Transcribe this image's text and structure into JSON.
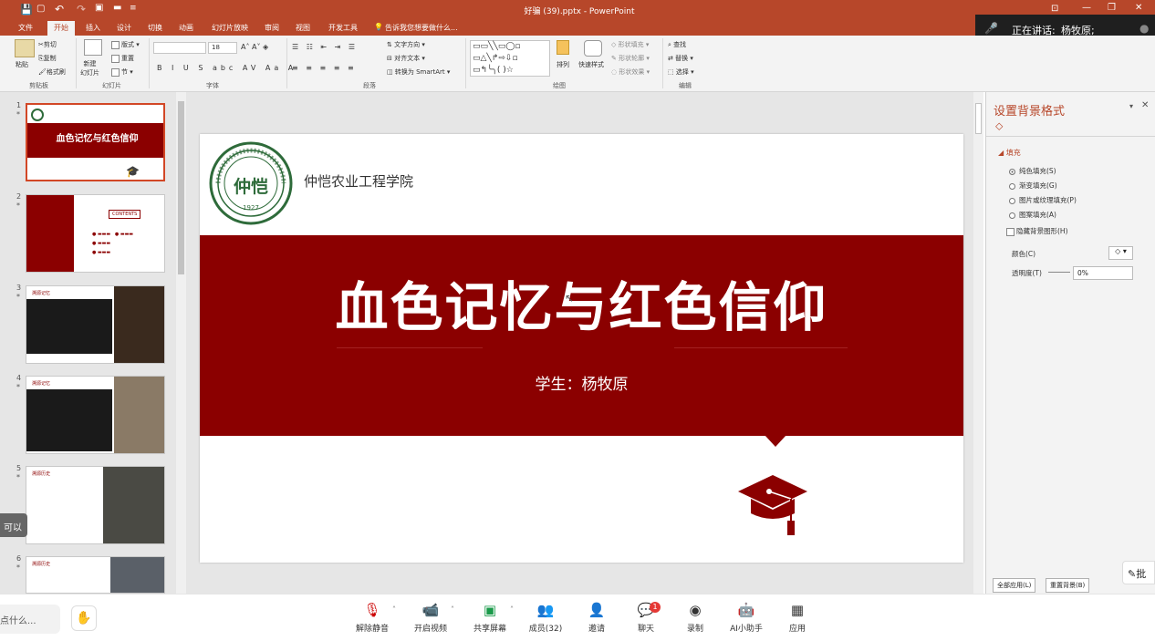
{
  "window": {
    "title": "好骗 (39).pptx - PowerPoint",
    "minimize": "—",
    "restore": "❐",
    "close": "✕",
    "ribbon_toggle": "⊡"
  },
  "qat": {
    "save": "💾",
    "undo": "↶",
    "redo": "↷",
    "more": "≡"
  },
  "tabs": [
    "文件",
    "开始",
    "插入",
    "设计",
    "切换",
    "动画",
    "幻灯片放映",
    "审阅",
    "视图",
    "开发工具"
  ],
  "active_tab": "开始",
  "tellme": "告诉我您想要做什么...",
  "ribbon": {
    "paste": "粘贴",
    "cut": "剪切",
    "copy": "复制",
    "format_painter": "格式刷",
    "new_slide": "新建\n幻灯片",
    "layout": "版式",
    "reset": "重置",
    "section": "节",
    "font_size": "18",
    "text_direction": "文字方向",
    "align_text": "对齐文本",
    "smartart": "转换为 SmartArt",
    "arrange": "排列",
    "quick_styles": "快速样式",
    "shape_fill": "形状填充",
    "shape_outline": "形状轮廓",
    "shape_effects": "形状效果",
    "find": "查找",
    "replace": "替换",
    "select": "选择",
    "groups": {
      "clipboard": "剪贴板",
      "slides": "幻灯片",
      "font": "字体",
      "paragraph": "段落",
      "drawing": "绘图",
      "editing": "编辑"
    }
  },
  "speaker": {
    "label": "正在讲话:",
    "name": "杨牧原;"
  },
  "thumbnails": [
    {
      "num": "1",
      "title": "血色记忆与红色信仰"
    },
    {
      "num": "2",
      "title": "CONTENTS"
    },
    {
      "num": "3",
      "title": "溯源记忆"
    },
    {
      "num": "4",
      "title": "溯源记忆"
    },
    {
      "num": "5",
      "title": "溯源历史"
    },
    {
      "num": "6",
      "title": "溯源历史"
    }
  ],
  "slide": {
    "org": "仲恺农业工程学院",
    "logo_text": "仲恺",
    "logo_year": "1927",
    "title": "血色记忆与红色信仰",
    "subtitle": "学生：杨牧原"
  },
  "pane": {
    "title": "设置背景格式",
    "section": "填充",
    "options": [
      "纯色填充(S)",
      "渐变填充(G)",
      "图片或纹理填充(P)",
      "图案填充(A)"
    ],
    "selected_option": "纯色填充(S)",
    "hide_bg": "隐藏背景图形(H)",
    "color_label": "颜色(C)",
    "transparency_label": "透明度(T)",
    "transparency_value": "0%",
    "apply_all": "全部应用(L)",
    "reset_bg": "重置背景(B)"
  },
  "side_labels": {
    "left_chip": "可以",
    "right_chip": "批"
  },
  "chat_placeholder": "点什么...",
  "bottom": {
    "mute": "解除静音",
    "video": "开启视频",
    "share": "共享屏幕",
    "members": "成员(32)",
    "invite": "邀请",
    "chat": "聊天",
    "chat_badge": "1",
    "record": "录制",
    "ai": "AI小助手",
    "apps": "应用"
  },
  "colors": {
    "accent": "#b7472a",
    "slide_red": "#8b0000",
    "speaker_bg": "#1f1f1f"
  }
}
